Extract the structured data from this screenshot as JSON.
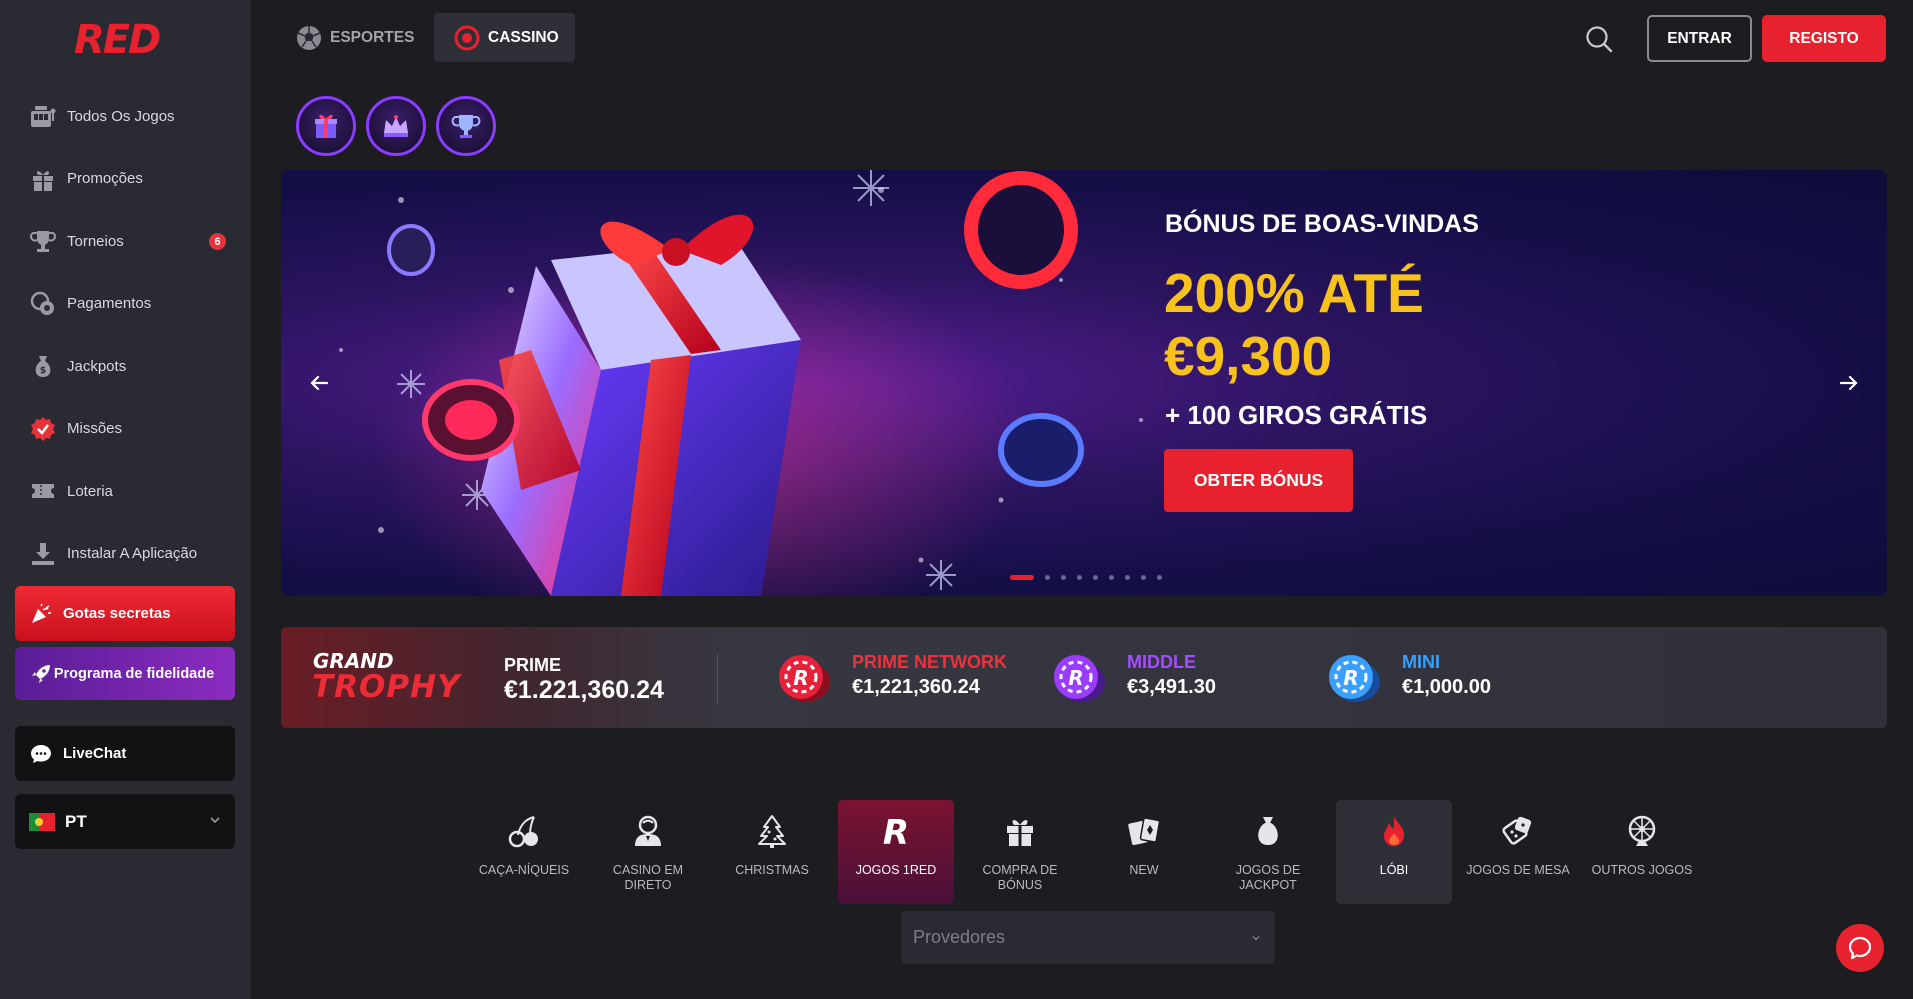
{
  "brand": {
    "logo_prefix": "RE",
    "logo_suffix": "D"
  },
  "sidebar": {
    "items": [
      {
        "label": "Todos Os Jogos"
      },
      {
        "label": "Promoções"
      },
      {
        "label": "Torneios",
        "badge": "6"
      },
      {
        "label": "Pagamentos"
      },
      {
        "label": "Jackpots"
      },
      {
        "label": "Missões"
      },
      {
        "label": "Loteria"
      },
      {
        "label": "Instalar A Aplicação"
      }
    ],
    "drops_label": "Gotas secretas",
    "loyalty_label": "Programa de fidelidade",
    "livechat_label": "LiveChat",
    "language": "PT"
  },
  "header": {
    "tab_sports": "ESPORTES",
    "tab_casino": "CASSINO",
    "login": "ENTRAR",
    "register": "REGISTO"
  },
  "banner": {
    "kicker": "BÓNUS DE BOAS-VINDAS",
    "amount": "200% ATÉ €9,300",
    "spins": "+ 100 GIROS GRÁTIS",
    "cta": "OBTER BÓNUS",
    "active_slide": 1,
    "slide_count": 9
  },
  "jackpot": {
    "brand_top": "GRAND",
    "brand_bottom": "TROPHY",
    "prime_name": "PRIME",
    "prime_value": "€1.221,360.24",
    "tiers": [
      {
        "name": "PRIME NETWORK",
        "value": "€1,221,360.24",
        "color": "#f0303c"
      },
      {
        "name": "MIDDLE",
        "value": "€3,491.30",
        "color": "#a34dff"
      },
      {
        "name": "MINI",
        "value": "€1,000.00",
        "color": "#3aa0ff"
      }
    ]
  },
  "categories": [
    {
      "label": "CAÇA-NÍQUEIS",
      "icon": "cherries-icon"
    },
    {
      "label": "CASINO EM DIRETO",
      "icon": "dealer-icon"
    },
    {
      "label": "CHRISTMAS",
      "icon": "christmas-tree-icon"
    },
    {
      "label": "JOGOS 1RED",
      "icon": "red-r-icon",
      "active": true
    },
    {
      "label": "COMPRA DE BÓNUS",
      "icon": "gift-icon"
    },
    {
      "label": "NEW",
      "icon": "cards-icon"
    },
    {
      "label": "JOGOS DE JACKPOT",
      "icon": "money-bag-icon"
    },
    {
      "label": "LÓBI",
      "icon": "flame-icon",
      "highlighted": true
    },
    {
      "label": "JOGOS DE MESA",
      "icon": "dice-icon"
    },
    {
      "label": "OUTROS JOGOS",
      "icon": "wheel-icon"
    }
  ],
  "providers": {
    "placeholder": "Provedores"
  },
  "colors": {
    "accent": "#e8212e",
    "gold": "#f7c21c",
    "sidebar": "#2a2a32",
    "page": "#1c1c21"
  }
}
